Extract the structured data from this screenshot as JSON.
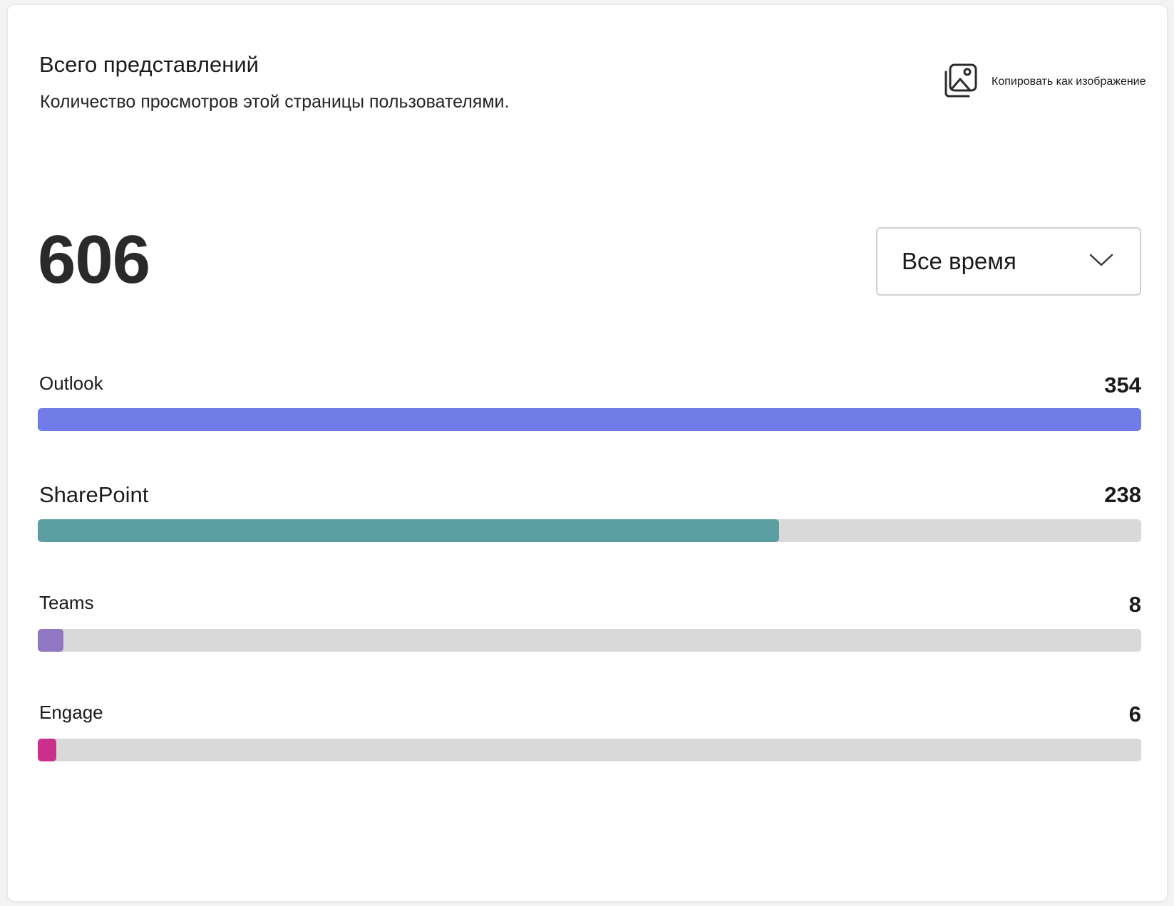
{
  "header": {
    "title": "Всего представлений",
    "subtitle": "Количество просмотров этой страницы пользователями."
  },
  "toolbar": {
    "copy_label": "Копировать как изображение"
  },
  "summary": {
    "total": "606"
  },
  "filter": {
    "selected": "Все время"
  },
  "breakdown": [
    {
      "label": "Outlook",
      "value": 354,
      "value_text": "354",
      "fill_fraction": 1.0,
      "color": "#727ce8"
    },
    {
      "label": "SharePoint",
      "value": 238,
      "value_text": "238",
      "fill_fraction": 0.672,
      "color": "#5b9ea2"
    },
    {
      "label": "Teams",
      "value": 8,
      "value_text": "8",
      "fill_fraction": 0.023,
      "color": "#8f78c1"
    },
    {
      "label": "Engage",
      "value": 6,
      "value_text": "6",
      "fill_fraction": 0.017,
      "color": "#cc2e8c"
    }
  ]
}
